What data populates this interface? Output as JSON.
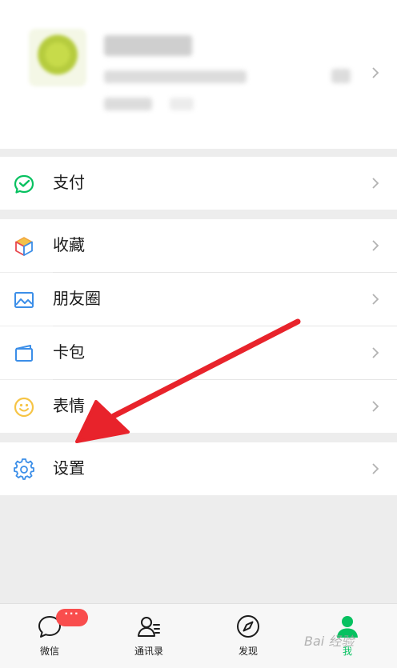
{
  "menu": {
    "pay": "支付",
    "favorites": "收藏",
    "moments": "朋友圈",
    "cards": "卡包",
    "stickers": "表情",
    "settings": "设置"
  },
  "tabs": [
    {
      "label": "微信",
      "badge": "···"
    },
    {
      "label": "通讯录"
    },
    {
      "label": "发现"
    },
    {
      "label": "我"
    }
  ],
  "watermark": "Bai 经验",
  "colors": {
    "accent": "#07c160",
    "pay_icon": "#07c160",
    "favorites_icon": "#f2a33a",
    "moments_icon": "#3b8ee8",
    "cards_icon": "#3b8ee8",
    "stickers_icon": "#f6c445",
    "settings_icon": "#3b8ee8",
    "badge": "#f94d4d",
    "annotation_arrow": "#e8232b"
  },
  "icons": {
    "pay": "wechat-pay-icon",
    "favorites": "cube-icon",
    "moments": "picture-icon",
    "cards": "card-wallet-icon",
    "stickers": "smiley-icon",
    "settings": "gear-icon"
  }
}
